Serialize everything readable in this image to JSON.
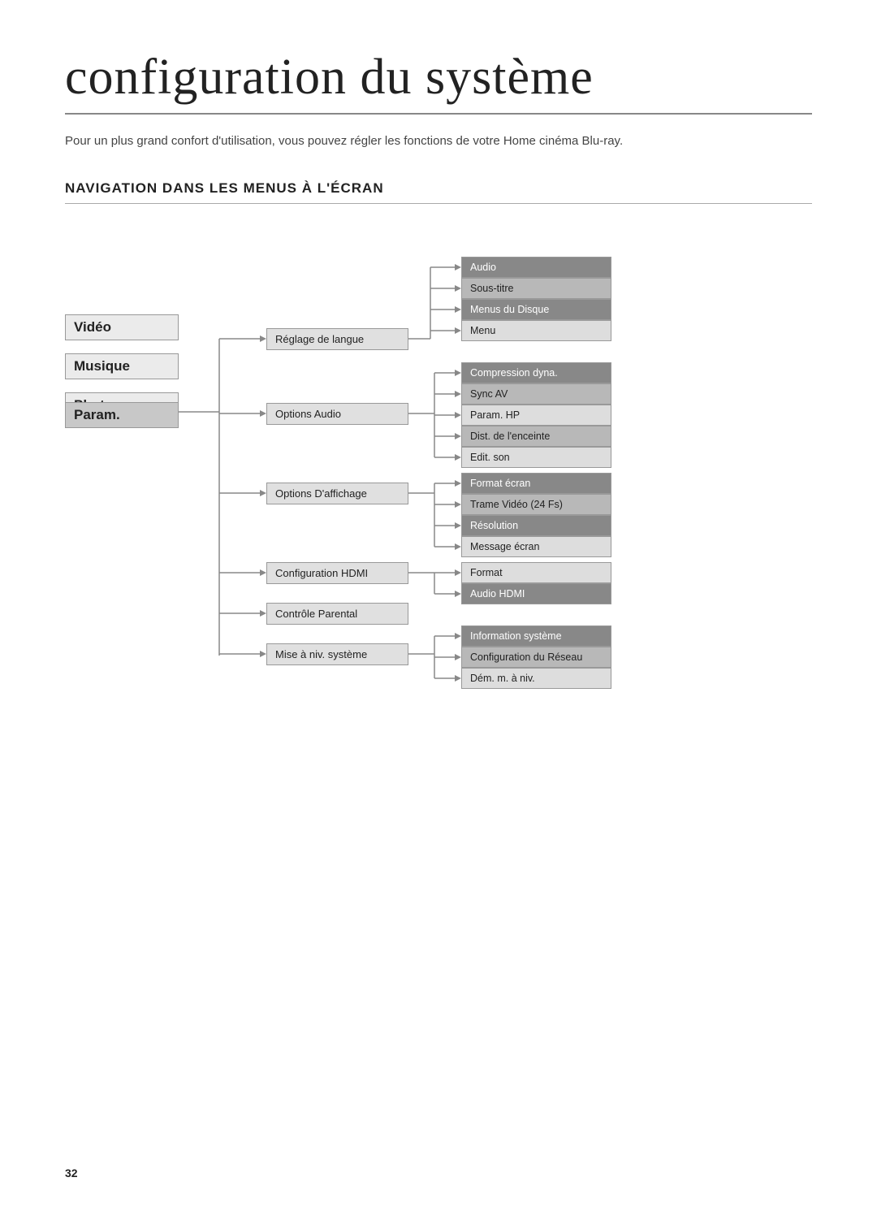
{
  "page": {
    "title": "configuration du système",
    "subtitle": "Pour un plus grand confort d'utilisation, vous pouvez régler les fonctions de votre Home cinéma Blu-ray.",
    "section_heading": "NAVIGATION DANS LES MENUS À L'ÉCRAN",
    "page_number": "32"
  },
  "menu": {
    "col1": [
      {
        "id": "video",
        "label": "Vidéo",
        "active": false
      },
      {
        "id": "musique",
        "label": "Musique",
        "active": false
      },
      {
        "id": "photo",
        "label": "Photo",
        "active": false
      },
      {
        "id": "param",
        "label": "Param.",
        "active": true
      }
    ],
    "col2": [
      {
        "id": "reglage-langue",
        "label": "Réglage de langue"
      },
      {
        "id": "options-audio",
        "label": "Options Audio"
      },
      {
        "id": "options-affichage",
        "label": "Options D'affichage"
      },
      {
        "id": "config-hdmi",
        "label": "Configuration HDMI"
      },
      {
        "id": "controle-parental",
        "label": "Contrôle Parental"
      },
      {
        "id": "mise-a-niv",
        "label": "Mise à niv. système"
      }
    ],
    "col3_reglage": [
      {
        "id": "audio",
        "label": "Audio",
        "style": "dark"
      },
      {
        "id": "sous-titre",
        "label": "Sous-titre",
        "style": "medium"
      },
      {
        "id": "menus-disque",
        "label": "Menus du Disque",
        "style": "dark"
      },
      {
        "id": "menu",
        "label": "Menu",
        "style": "light"
      }
    ],
    "col3_options_audio": [
      {
        "id": "compression-dyna",
        "label": "Compression dyna.",
        "style": "dark"
      },
      {
        "id": "sync-av",
        "label": "Sync AV",
        "style": "medium"
      },
      {
        "id": "param-hp",
        "label": "Param. HP",
        "style": "light"
      },
      {
        "id": "dist-enceinte",
        "label": "Dist. de l'enceinte",
        "style": "medium"
      },
      {
        "id": "edit-son",
        "label": "Edit. son",
        "style": "light"
      }
    ],
    "col3_options_affichage": [
      {
        "id": "format-ecran",
        "label": "Format écran",
        "style": "dark"
      },
      {
        "id": "trame-video",
        "label": "Trame Vidéo (24 Fs)",
        "style": "medium"
      },
      {
        "id": "resolution",
        "label": "Résolution",
        "style": "dark"
      },
      {
        "id": "message-ecran",
        "label": "Message écran",
        "style": "light"
      }
    ],
    "col3_config_hdmi": [
      {
        "id": "format",
        "label": "Format",
        "style": "light"
      },
      {
        "id": "audio-hdmi",
        "label": "Audio HDMI",
        "style": "dark"
      }
    ],
    "col3_mise_a_niv": [
      {
        "id": "info-systeme",
        "label": "Information système",
        "style": "dark"
      },
      {
        "id": "config-reseau",
        "label": "Configuration du Réseau",
        "style": "medium"
      },
      {
        "id": "dem-m-niv",
        "label": "Dém. m. à niv.",
        "style": "light"
      }
    ]
  }
}
